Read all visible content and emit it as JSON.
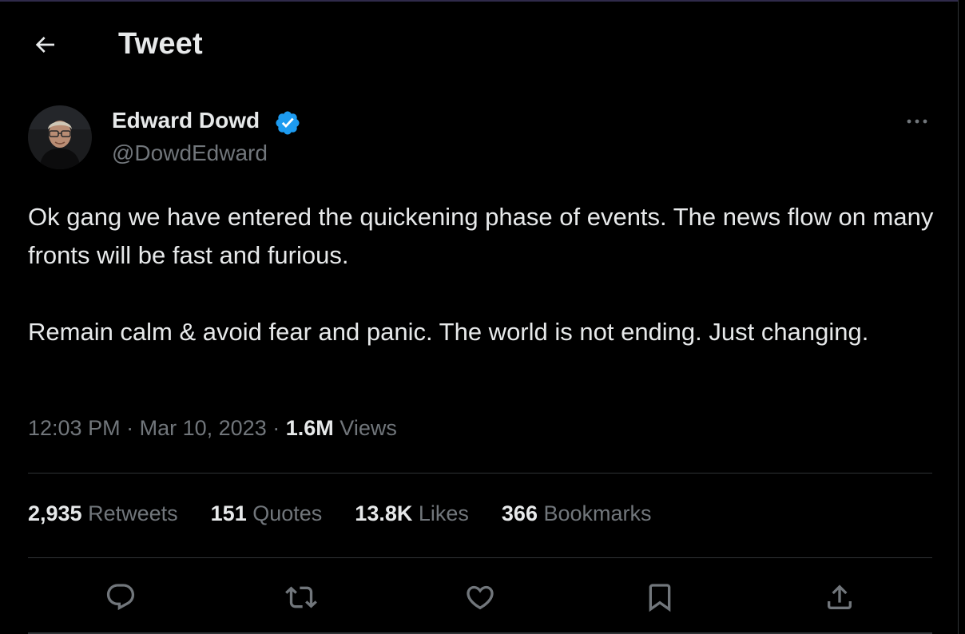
{
  "header": {
    "title": "Tweet",
    "back_icon": "arrow-left-icon"
  },
  "author": {
    "name": "Edward Dowd",
    "handle": "@DowdEdward",
    "verified": true,
    "verified_color": "#1d9bf0"
  },
  "tweet": {
    "paragraphs": [
      "Ok gang we have entered the quickening phase of events. The news flow on many fronts will be fast and furious.",
      "Remain calm & avoid fear and panic. The world is not ending. Just changing."
    ],
    "time": "12:03 PM",
    "separator": "·",
    "date": "Mar 10, 2023",
    "views_count": "1.6M",
    "views_label": "Views"
  },
  "stats": {
    "retweets": {
      "count": "2,935",
      "label": "Retweets"
    },
    "quotes": {
      "count": "151",
      "label": "Quotes"
    },
    "likes": {
      "count": "13.8K",
      "label": "Likes"
    },
    "bookmarks": {
      "count": "366",
      "label": "Bookmarks"
    }
  },
  "actions": [
    "reply-icon",
    "retweet-icon",
    "like-icon",
    "bookmark-icon",
    "share-icon"
  ],
  "colors": {
    "background": "#000000",
    "text_primary": "#e7e9ea",
    "text_secondary": "#71767b",
    "divider": "#2f3336",
    "accent": "#1d9bf0"
  }
}
